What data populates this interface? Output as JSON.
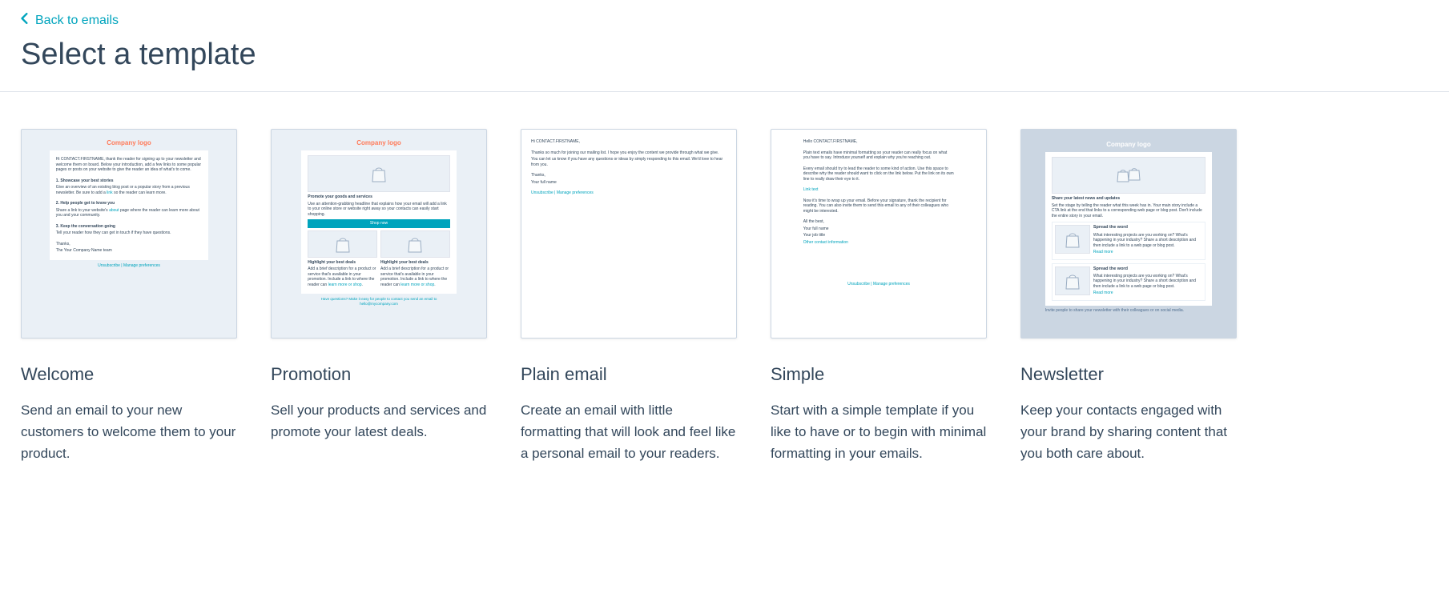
{
  "back_link": "Back to emails",
  "page_title": "Select a template",
  "mini": {
    "company_logo": "Company logo",
    "shop_now": "Shop now",
    "promote_heading": "Promote your goods and services",
    "highlight_heading": "Highlight your best deals",
    "spread_heading": "Spread the word",
    "news_heading": "Share your latest news and updates",
    "read_more": "Read more"
  },
  "templates": [
    {
      "id": "welcome",
      "name": "Welcome",
      "desc": "Send an email to your new customers to welcome them to your product."
    },
    {
      "id": "promotion",
      "name": "Promotion",
      "desc": "Sell your products and services and promote your latest deals."
    },
    {
      "id": "plain",
      "name": "Plain email",
      "desc": "Create an email with little formatting that will look and feel like a personal email to your readers."
    },
    {
      "id": "simple",
      "name": "Simple",
      "desc": "Start with a simple template if you like to have or to begin with minimal formatting in your emails."
    },
    {
      "id": "newsletter",
      "name": "Newsletter",
      "desc": "Keep your contacts engaged with your brand by sharing content that you both care about."
    }
  ]
}
